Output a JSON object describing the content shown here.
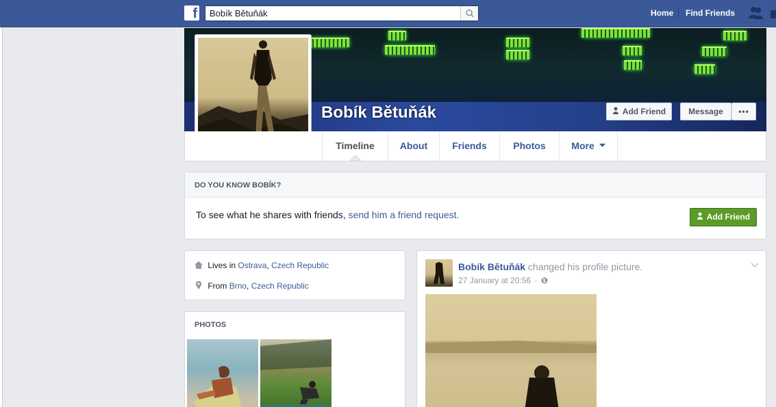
{
  "topbar": {
    "search_value": "Bobík Bětuňák",
    "nav_home": "Home",
    "nav_find_friends": "Find Friends",
    "brand_color": "#3b5998"
  },
  "profile": {
    "name": "Bobík Bětuňák",
    "add_friend_label": "Add Friend",
    "message_label": "Message",
    "more_dots": "•••"
  },
  "tabs": [
    {
      "label": "Timeline"
    },
    {
      "label": "About"
    },
    {
      "label": "Friends"
    },
    {
      "label": "Photos"
    },
    {
      "label": "More"
    }
  ],
  "know_box": {
    "heading": "DO YOU KNOW BOBÍK?",
    "text": "To see what he shares with friends,",
    "link": "send him a friend request.",
    "button": "Add Friend",
    "button_color": "#5b9c27"
  },
  "intro": {
    "lives_prefix": "Lives in",
    "lives_city": "Ostrava",
    "lives_country": "Czech Republic",
    "from_prefix": "From",
    "from_city": "Brno",
    "from_country": "Czech Republic"
  },
  "photos": {
    "heading": "PHOTOS"
  },
  "post": {
    "author": "Bobík Bětuňák",
    "action": "changed his profile picture.",
    "timestamp": "27 January at 20:56"
  }
}
